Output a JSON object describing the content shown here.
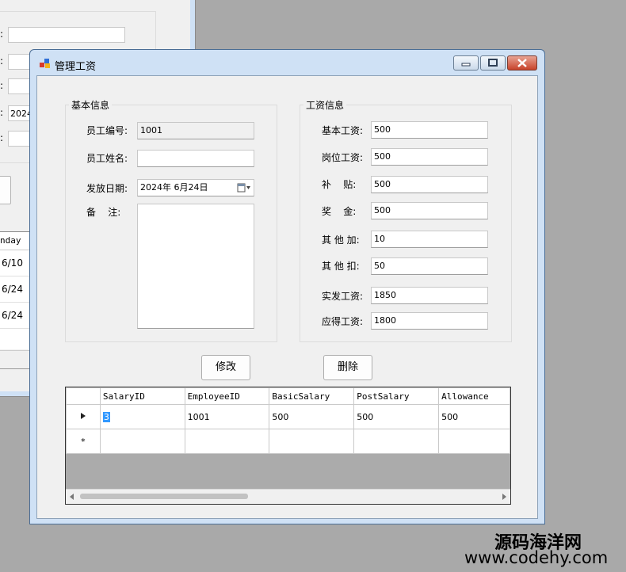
{
  "bg_window": {
    "text_value": "2024",
    "grid_header": "nday",
    "grid_rows": [
      "6/10",
      "6/24",
      "6/24"
    ]
  },
  "dialog": {
    "title": "管理工资",
    "basic_group": {
      "title": "基本信息",
      "employee_id_label": "员工编号:",
      "employee_id_value": "1001",
      "employee_name_label": "员工姓名:",
      "employee_name_value": "",
      "pay_date_label": "发放日期:",
      "pay_date_value": "2024年 6月24日",
      "remark_label": "备    注:",
      "remark_value": ""
    },
    "salary_group": {
      "title": "工资信息",
      "fields": [
        {
          "label": "基本工资:",
          "value": "500"
        },
        {
          "label": "岗位工资:",
          "value": "500"
        },
        {
          "label": "补    贴:",
          "value": "500"
        },
        {
          "label": "奖    金:",
          "value": "500"
        },
        {
          "label": "其 他 加:",
          "value": "10"
        },
        {
          "label": "其 他 扣:",
          "value": "50"
        },
        {
          "label": "实发工资:",
          "value": "1850"
        },
        {
          "label": "应得工资:",
          "value": "1800"
        }
      ]
    },
    "buttons": {
      "modify": "修改",
      "delete": "删除"
    },
    "grid": {
      "columns": [
        "SalaryID",
        "EmployeeID",
        "BasicSalary",
        "PostSalary",
        "Allowance"
      ],
      "rows": [
        [
          "3",
          "1001",
          "500",
          "500",
          "500"
        ]
      ],
      "new_row_marker": "*"
    }
  },
  "watermark": {
    "line1": "源码海洋网",
    "line2": "www.codehy.com"
  },
  "colors": {
    "title_frame": "#cfe1f5",
    "close_button": "#c7432a",
    "selection": "#3399ff"
  }
}
